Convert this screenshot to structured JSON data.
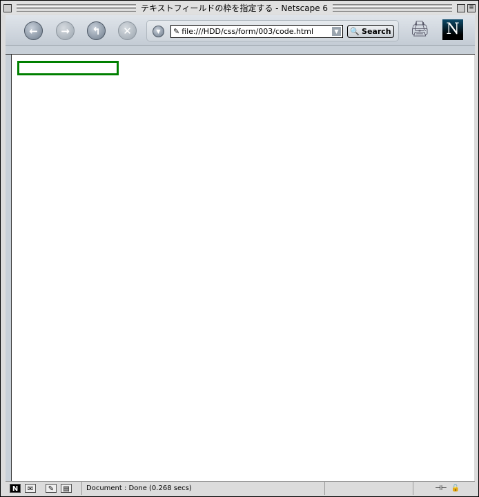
{
  "window": {
    "title": "テキストフィールドの枠を指定する - Netscape 6"
  },
  "toolbar": {
    "back": "back",
    "forward": "forward",
    "reload": "reload",
    "stop": "stop",
    "url": "file:///HDD/css/form/003/code.html",
    "search_label": "Search",
    "logo": "N"
  },
  "content": {
    "text_field_value": "",
    "text_field_border_color": "#008000"
  },
  "status": {
    "text": "Document : Done (0.268 secs)"
  }
}
